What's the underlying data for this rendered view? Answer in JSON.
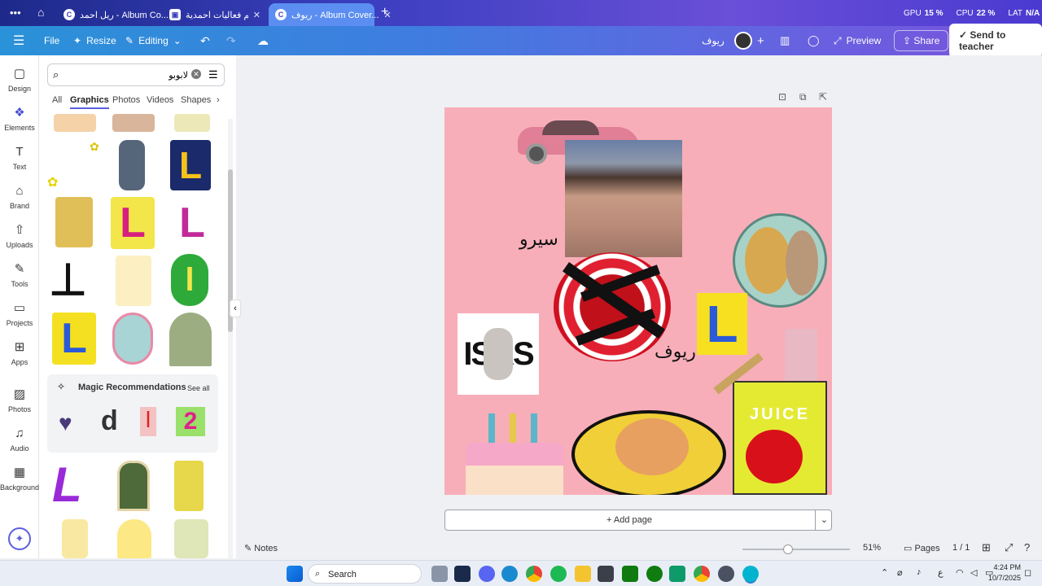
{
  "tabs": [
    {
      "label": "ريل احمد - Album Co...",
      "active": false
    },
    {
      "label": "حياكم فعاليات احمدية ...",
      "active": false
    },
    {
      "label": "ريوف - Album Cover...",
      "active": true
    }
  ],
  "perf": {
    "gpu_label": "GPU",
    "gpu_value": "15 %",
    "cpu_label": "CPU",
    "cpu_value": "22 %",
    "net_label": "LAT",
    "net_value": "N/A"
  },
  "toolbar": {
    "file": "File",
    "resize": "Resize",
    "editing": "Editing",
    "design_name": "ريوف",
    "preview": "Preview",
    "share": "Share",
    "send_to_teacher": "Send to teacher"
  },
  "rail": [
    {
      "label": "Design",
      "icon": "design-icon"
    },
    {
      "label": "Elements",
      "icon": "elements-icon"
    },
    {
      "label": "Text",
      "icon": "text-icon"
    },
    {
      "label": "Brand",
      "icon": "brand-icon"
    },
    {
      "label": "Uploads",
      "icon": "upload-icon"
    },
    {
      "label": "Tools",
      "icon": "tools-icon"
    },
    {
      "label": "Projects",
      "icon": "folder-icon"
    },
    {
      "label": "Apps",
      "icon": "apps-icon"
    },
    {
      "label": "Photos",
      "icon": "photo-icon"
    },
    {
      "label": "Audio",
      "icon": "audio-icon"
    },
    {
      "label": "Background",
      "icon": "background-icon"
    }
  ],
  "panel": {
    "search_value": "لابوبو",
    "tabs": [
      "All",
      "Graphics",
      "Photos",
      "Videos",
      "Shapes"
    ],
    "active_tab": "Graphics",
    "magic_title": "Magic Recommendations",
    "see_all": "See all"
  },
  "canvas": {
    "text_siro": "سيرو",
    "text_riyouf": "ريوف",
    "juice": "JUICE",
    "sticker_text": "ISAS",
    "add_page": "+ Add page"
  },
  "bottom": {
    "notes": "Notes",
    "zoom": "51%",
    "pages": "Pages",
    "page_count": "1 / 1"
  },
  "taskbar": {
    "search": "Search",
    "lang": "ع",
    "time": "4:24 PM",
    "date": "10/7/2025"
  },
  "colors": {
    "canvas_bg": "#f8aeb9",
    "accent": "#5b5fe0"
  }
}
